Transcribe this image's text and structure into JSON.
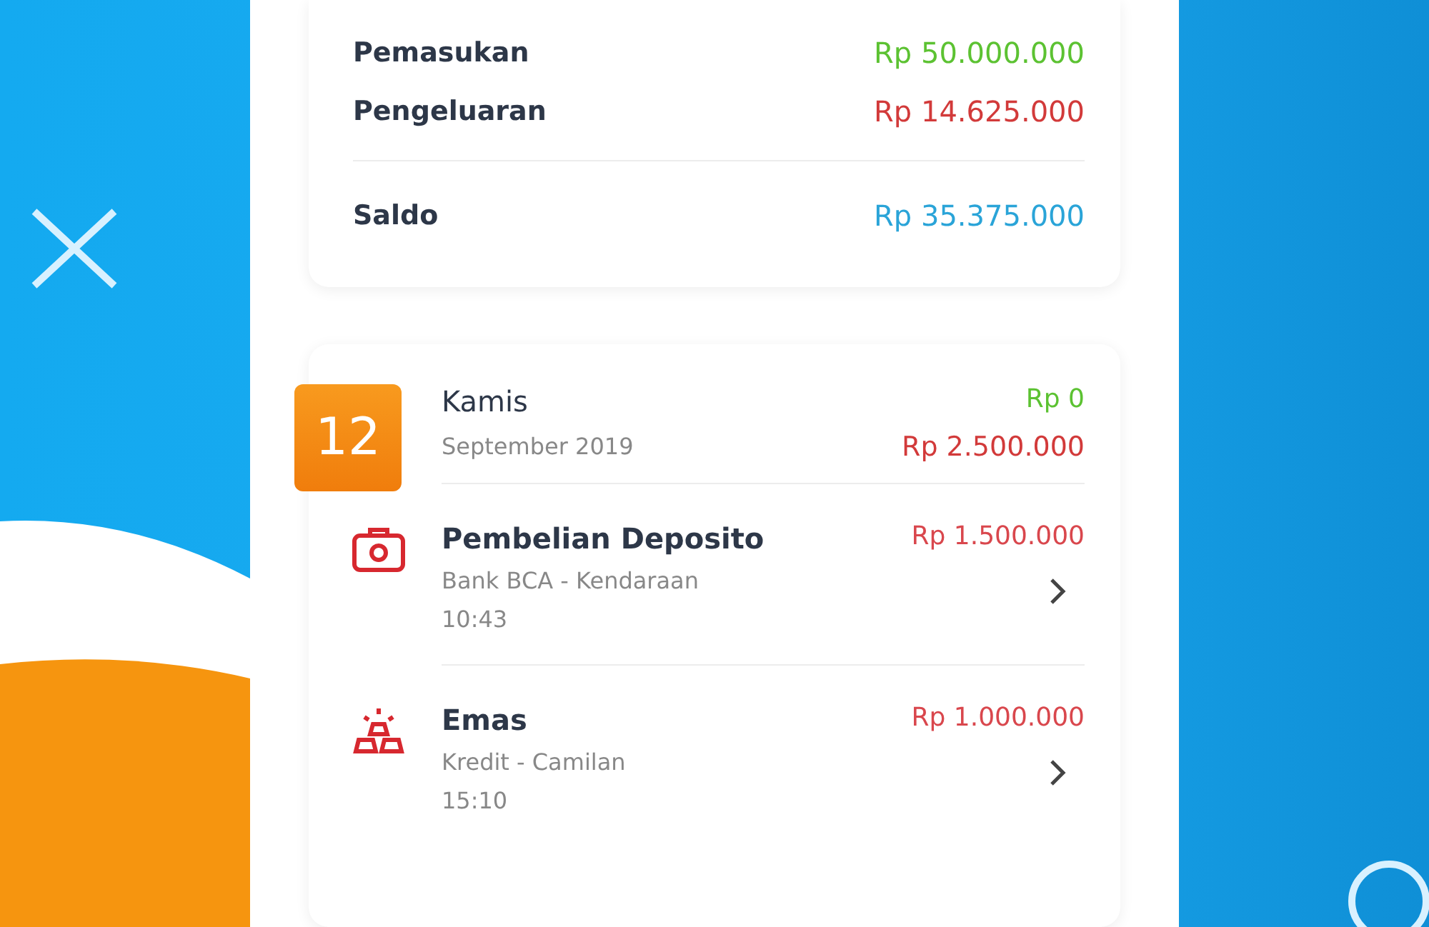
{
  "summary": {
    "rows": [
      {
        "label": "Pemasukan",
        "amount": "Rp 50.000.000",
        "kind": "income"
      },
      {
        "label": "Pengeluaran",
        "amount": "Rp 14.625.000",
        "kind": "expense"
      },
      {
        "label": "Saldo",
        "amount": "Rp 35.375.000",
        "kind": "balance"
      }
    ]
  },
  "day": {
    "date": "12",
    "weekday": "Kamis",
    "month": "September 2019",
    "income": "Rp 0",
    "expense": "Rp 2.500.000",
    "transactions": [
      {
        "title": "Pembelian Deposito",
        "detail": "Bank BCA - Kendaraan",
        "time": "10:43",
        "amount": "Rp 1.500.000"
      },
      {
        "title": "Emas",
        "detail": "Kredit - Camilan",
        "time": "15:10",
        "amount": "Rp 1.000.000"
      }
    ]
  }
}
